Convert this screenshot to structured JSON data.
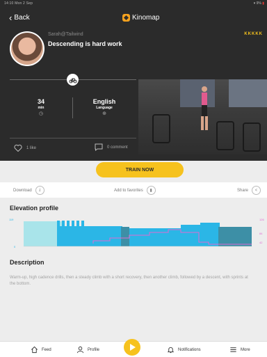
{
  "status_bar": {
    "time": "14:10",
    "date": "Mon 2 Sep",
    "right": "▾ 9%"
  },
  "header": {
    "back_label": "Back",
    "brand": "Kinomap"
  },
  "video_info": {
    "author": "Sarah@Tailwind",
    "title": "Descending is hard work",
    "difficulty": "KKKKK",
    "duration_value": "34",
    "duration_unit": "min",
    "language_value": "English",
    "language_label": "Language",
    "likes": "1 like",
    "comments": "0 comment"
  },
  "train_button": "TRAIN NOW",
  "actions": {
    "download": "Download",
    "favorites": "Add to favorites",
    "share": "Share"
  },
  "elevation": {
    "title": "Elevation profile",
    "left_top": "119",
    "left_bottom": "0",
    "right_top": "126",
    "right_mid": "84",
    "right_bottom": "42"
  },
  "description": {
    "title": "Description",
    "text": "Warm-up, high cadence drills, then a steady climb with a short recovery, then another climb, followed by a descent, with sprints at the bottom."
  },
  "tabbar": {
    "feed": "Feed",
    "profile": "Profile",
    "notifications": "Notifications",
    "more": "More"
  },
  "colors": {
    "accent": "#f6c21e",
    "dark_bg": "#2b2b2b",
    "profile_light": "#a9e4ea",
    "profile_blue": "#2bb6e6",
    "profile_dark": "#3d8fa6",
    "power_line": "#e06ad2"
  },
  "icons": [
    "bike-icon",
    "clock-icon",
    "globe-icon",
    "heart-icon",
    "comment-icon",
    "download-icon",
    "bookmark-icon",
    "share-icon",
    "home-icon",
    "user-icon",
    "play-icon",
    "bell-icon",
    "menu-icon"
  ]
}
